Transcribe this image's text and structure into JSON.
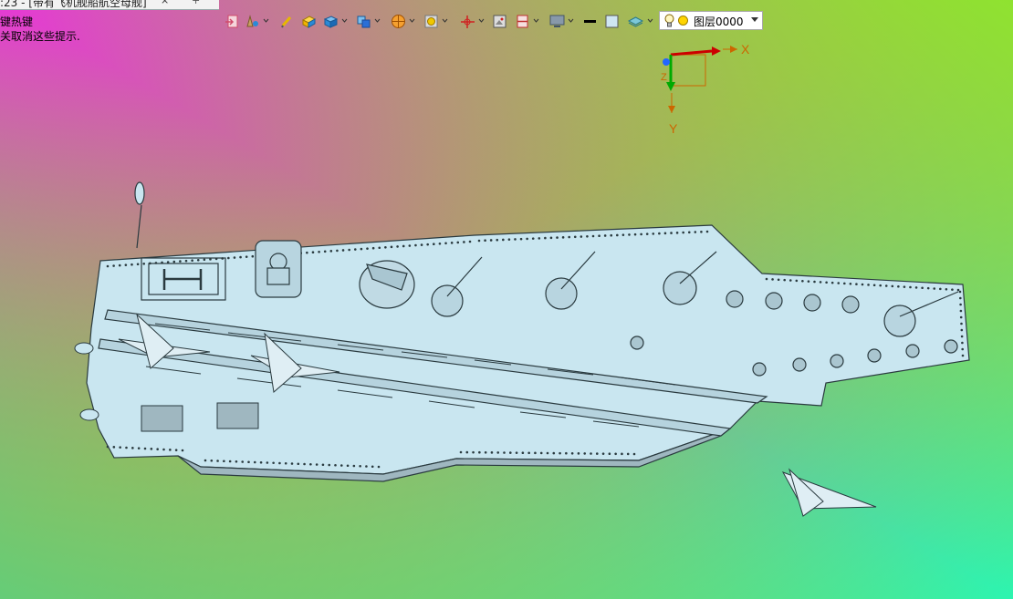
{
  "window": {
    "tab_label": ":23 - [带有飞机舰船航空母舰]",
    "tab_close_symbol": "×",
    "tab_add_symbol": "+"
  },
  "hints": {
    "line1": "键热键",
    "line2": "关取消这些提示."
  },
  "toolbar": {
    "tools": [
      {
        "name": "import-icon",
        "color": "#d04a6a"
      },
      {
        "name": "shape-tool-icon",
        "color": "#7a5a2a"
      },
      {
        "name": "pen-icon",
        "color": "#e6b800"
      },
      {
        "name": "cube-yellow-icon",
        "color": "#f0b400"
      },
      {
        "name": "cube-blue-icon",
        "color": "#2a8ad6"
      },
      {
        "name": "cube-split-icon",
        "color": "#2a6fd6"
      },
      {
        "name": "render-sphere-icon",
        "color": "#e07a10"
      },
      {
        "name": "view-frame-icon",
        "color": "#d4a800"
      },
      {
        "name": "origin-icon",
        "color": "#d02020"
      },
      {
        "name": "image-view-icon",
        "color": "#555555"
      },
      {
        "name": "section-icon",
        "color": "#c03030"
      },
      {
        "name": "monitor-icon",
        "color": "#445566"
      },
      {
        "name": "line-style-icon",
        "color": "#000000"
      },
      {
        "name": "color-swatch-icon",
        "color": "#cfe6f2"
      },
      {
        "name": "layers-icon",
        "color": "#3aa0b8"
      }
    ],
    "layer": {
      "value": "图层0000"
    }
  },
  "triad": {
    "x_label": "X",
    "y_label": "Y",
    "z_label": "Z",
    "x_color": "#cc0000",
    "y_color": "#00aa00",
    "z_color": "#2266ff",
    "label_color": "#cc6600"
  },
  "colors": {
    "background_top_left": "#e638d6",
    "background_top_right": "#8ee62c",
    "background_bottom_right": "#2cf5b0",
    "background_bottom_left": "#5ed178",
    "model_fill": "#c9e6f0",
    "model_stroke": "#2a3a3f"
  }
}
